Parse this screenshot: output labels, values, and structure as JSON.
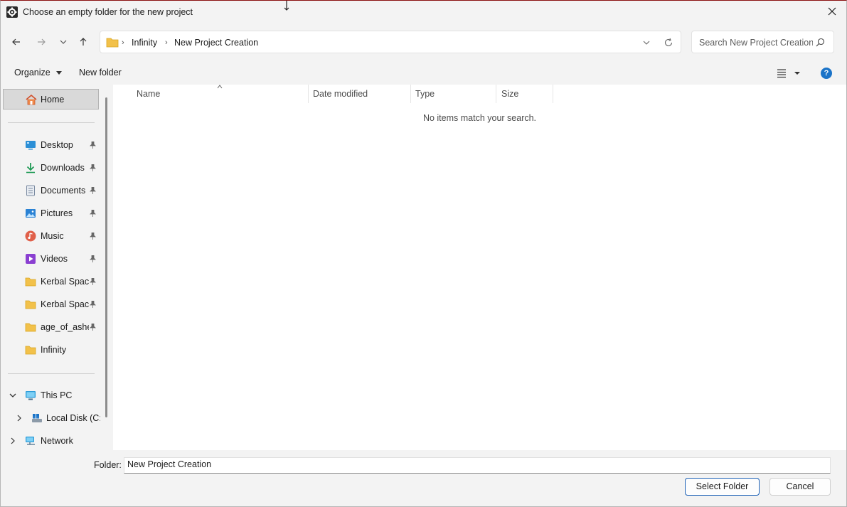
{
  "window": {
    "title": "Choose an empty folder for the new project",
    "app_icon": "gear-icon",
    "close_icon": "close-icon"
  },
  "nav": {
    "back_icon": "arrow-left-icon",
    "forward_icon": "arrow-right-icon",
    "recent_icon": "chevron-down-icon",
    "up_icon": "arrow-up-icon"
  },
  "address": {
    "icon": "folder-icon",
    "breadcrumbs": [
      "Infinity",
      "New Project Creation"
    ],
    "dropdown_icon": "chevron-down-icon",
    "refresh_icon": "refresh-icon"
  },
  "search": {
    "placeholder": "Search New Project Creation",
    "icon": "search-icon"
  },
  "toolbar": {
    "organize_label": "Organize",
    "new_folder_label": "New folder",
    "view_icon": "list-view-icon",
    "help_icon": "help-icon",
    "help_glyph": "?"
  },
  "sidebar": {
    "home": {
      "label": "Home",
      "icon": "home-icon"
    },
    "quick_access": [
      {
        "label": "Desktop",
        "icon": "desktop-icon",
        "color": "#2b8fd6"
      },
      {
        "label": "Downloads",
        "icon": "download-icon",
        "color": "#1f9a55"
      },
      {
        "label": "Documents",
        "icon": "document-icon",
        "color": "#7a8aa0"
      },
      {
        "label": "Pictures",
        "icon": "pictures-icon",
        "color": "#2a82d4"
      },
      {
        "label": "Music",
        "icon": "music-icon",
        "color": "#e0604a"
      },
      {
        "label": "Videos",
        "icon": "video-icon",
        "color": "#8a3fd1"
      },
      {
        "label": "Kerbal Space",
        "icon": "folder-icon",
        "color": "#f2c14a"
      },
      {
        "label": "Kerbal Space",
        "icon": "folder-icon",
        "color": "#f2c14a"
      },
      {
        "label": "age_of_ashes",
        "icon": "folder-icon",
        "color": "#f2c14a"
      },
      {
        "label": "Infinity",
        "icon": "folder-icon",
        "color": "#f2c14a"
      }
    ],
    "this_pc": {
      "label": "This PC",
      "icon": "computer-icon"
    },
    "local_disk": {
      "label": "Local Disk (C:)",
      "icon": "drive-icon"
    },
    "network": {
      "label": "Network",
      "icon": "network-icon"
    }
  },
  "columns": [
    "Name",
    "Date modified",
    "Type",
    "Size"
  ],
  "empty_message": "No items match your search.",
  "footer": {
    "folder_label": "Folder:",
    "folder_value": "New Project Creation",
    "select_button": "Select Folder",
    "cancel_button": "Cancel"
  },
  "colors": {
    "accent": "#1a73c8",
    "selection": "#d9d9d9",
    "folder": "#f2c14a"
  }
}
